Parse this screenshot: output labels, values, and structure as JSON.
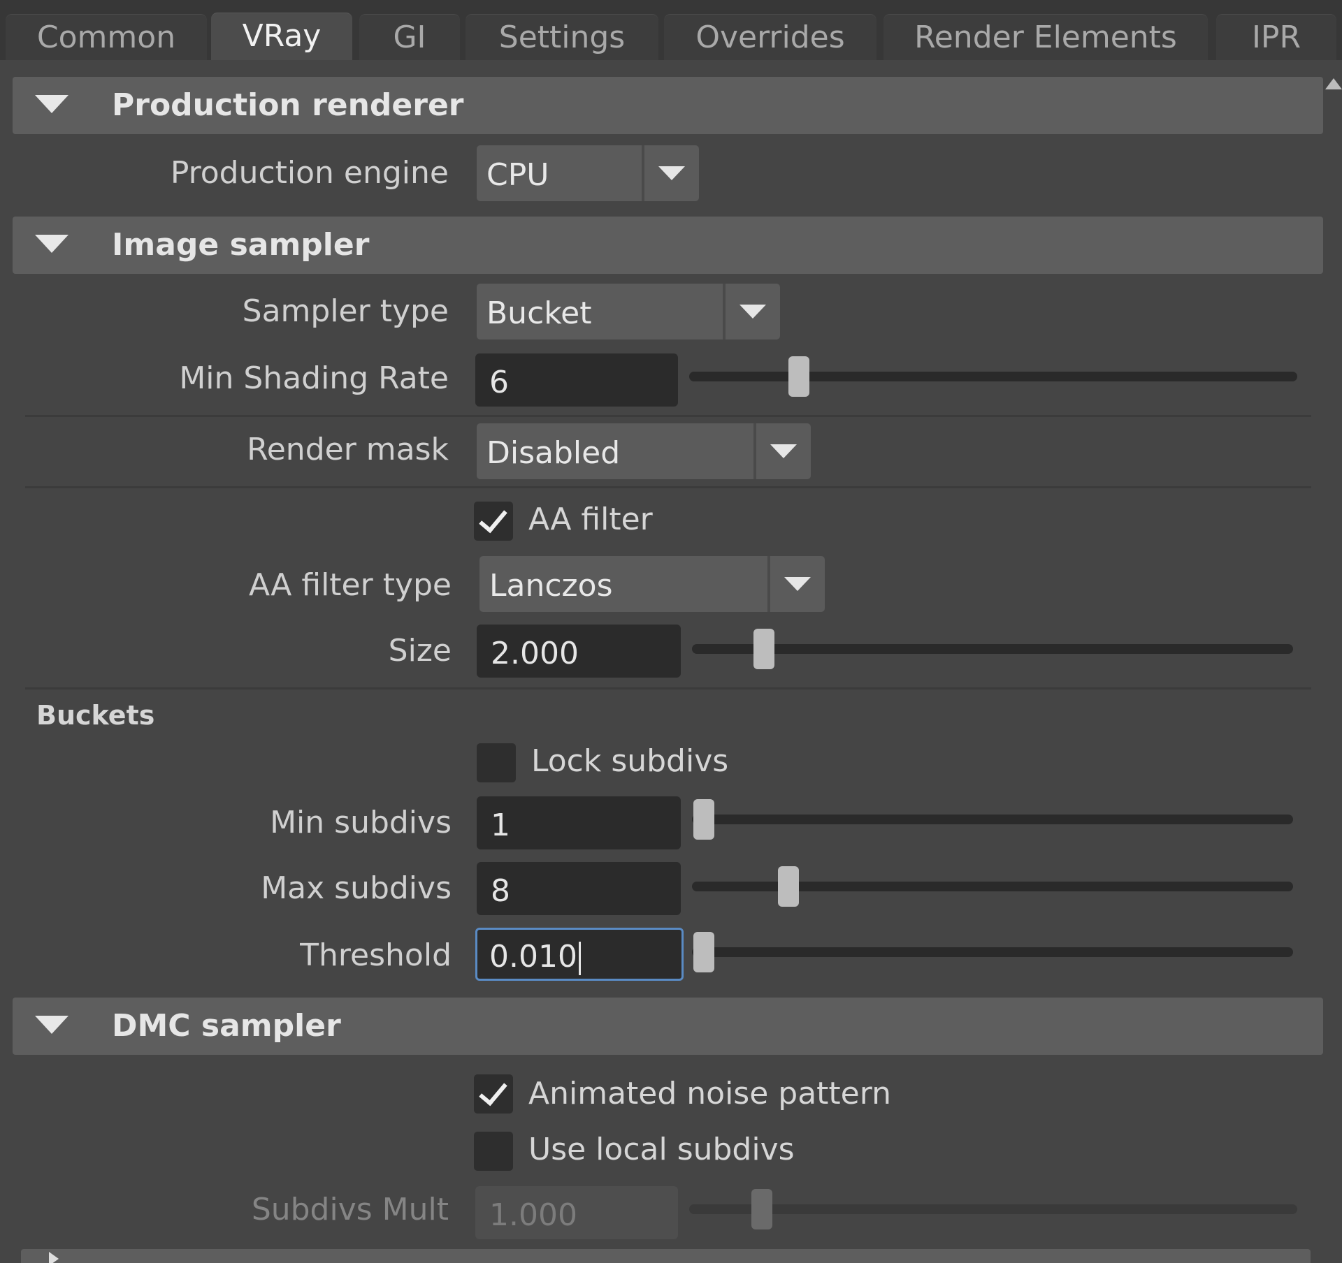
{
  "tabs": [
    {
      "label": "Common",
      "active": false
    },
    {
      "label": "VRay",
      "active": true
    },
    {
      "label": "GI",
      "active": false
    },
    {
      "label": "Settings",
      "active": false
    },
    {
      "label": "Overrides",
      "active": false
    },
    {
      "label": "Render Elements",
      "active": false
    },
    {
      "label": "IPR",
      "active": false
    }
  ],
  "production_renderer": {
    "title": "Production renderer",
    "engine_label": "Production engine",
    "engine_value": "CPU"
  },
  "image_sampler": {
    "title": "Image sampler",
    "sampler_type_label": "Sampler type",
    "sampler_type_value": "Bucket",
    "min_shading_rate_label": "Min Shading Rate",
    "min_shading_rate_value": "6",
    "min_shading_rate_slider": 0.18,
    "render_mask_label": "Render mask",
    "render_mask_value": "Disabled",
    "aa_filter_label": "AA filter",
    "aa_filter_checked": true,
    "aa_filter_type_label": "AA filter type",
    "aa_filter_type_value": "Lanczos",
    "size_label": "Size",
    "size_value": "2.000",
    "size_slider": 0.12,
    "buckets_label": "Buckets",
    "lock_subdivs_label": "Lock subdivs",
    "lock_subdivs_checked": false,
    "min_subdivs_label": "Min subdivs",
    "min_subdivs_value": "1",
    "min_subdivs_slider": 0.02,
    "max_subdivs_label": "Max subdivs",
    "max_subdivs_value": "8",
    "max_subdivs_slider": 0.16,
    "threshold_label": "Threshold",
    "threshold_value": "0.010",
    "threshold_slider": 0.02
  },
  "dmc_sampler": {
    "title": "DMC sampler",
    "animated_noise_label": "Animated noise pattern",
    "animated_noise_checked": true,
    "use_local_subdivs_label": "Use local subdivs",
    "use_local_subdivs_checked": false,
    "subdivs_mult_label": "Subdivs Mult",
    "subdivs_mult_value": "1.000",
    "subdivs_mult_slider": 0.12
  },
  "colors": {
    "focus_border": "#5a8bc4",
    "section_header": "#5e5e5e",
    "panel_bg": "#444444"
  }
}
